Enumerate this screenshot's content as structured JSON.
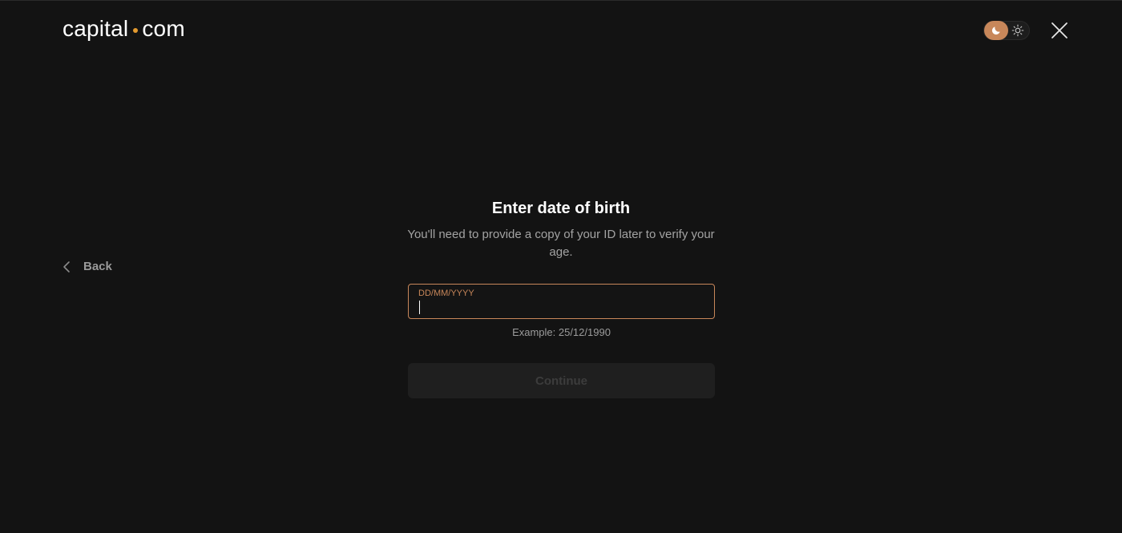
{
  "header": {
    "logo_left": "capital",
    "logo_right": "com",
    "theme_toggle": {
      "active_mode": "dark",
      "moon_icon": "moon-icon",
      "sun_icon": "sun-icon"
    },
    "close_icon": "close-icon"
  },
  "nav": {
    "back_label": "Back",
    "back_icon": "chevron-left-icon"
  },
  "form": {
    "title": "Enter date of birth",
    "subtitle": "You'll need to provide a copy of your ID later to verify your age.",
    "dob_label": "DD/MM/YYYY",
    "dob_value": "",
    "example": "Example: 25/12/1990",
    "continue_label": "Continue",
    "continue_enabled": false
  },
  "colors": {
    "background": "#131313",
    "accent": "#c8875a",
    "text_primary": "#ffffff",
    "text_secondary": "#a3a3a3",
    "button_disabled_bg": "#1f1f1f",
    "button_disabled_text": "#3c3c3c"
  }
}
